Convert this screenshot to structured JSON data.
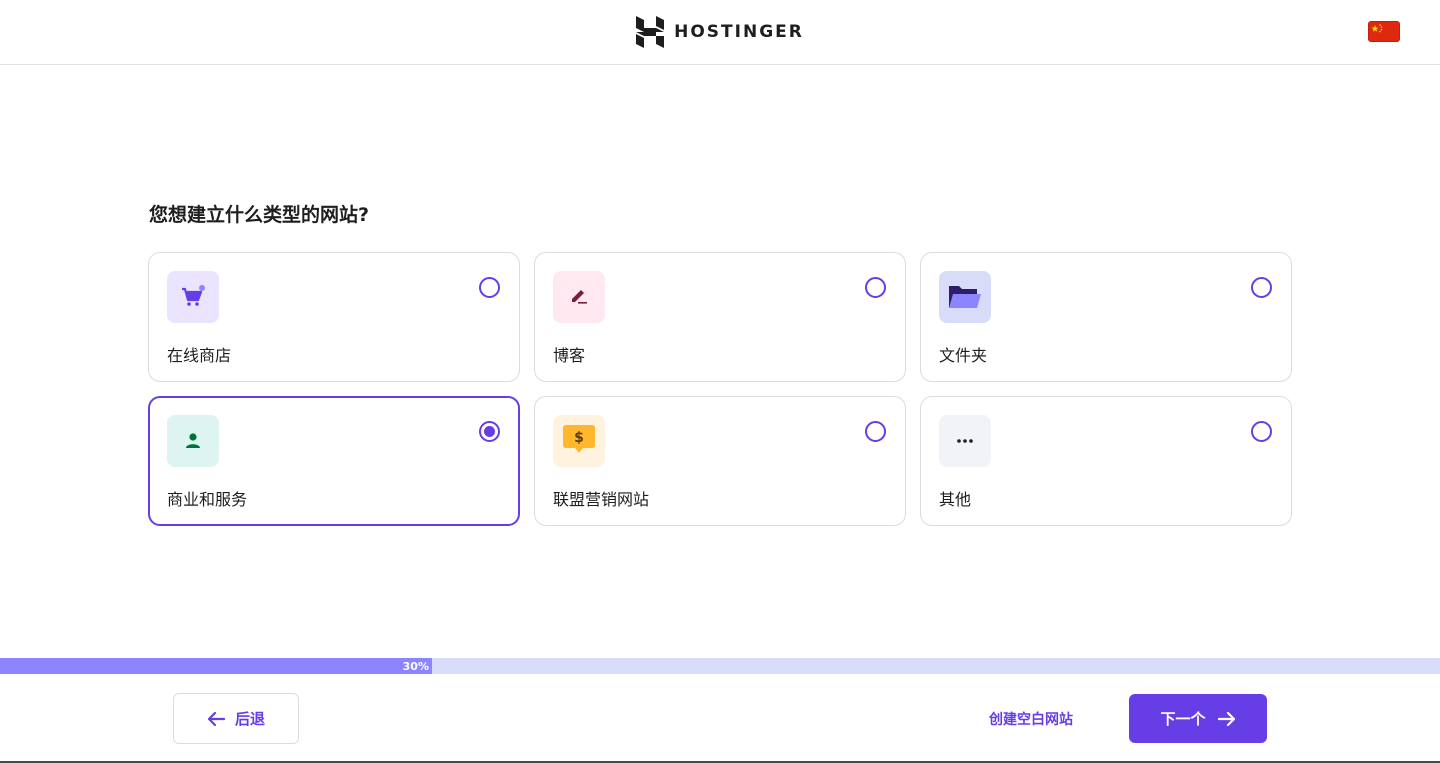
{
  "header": {
    "brand": "HOSTINGER",
    "language_flag_icon": "china-flag-icon"
  },
  "question": "您想建立什么类型的网站?",
  "options": [
    {
      "label": "在线商店",
      "icon": "shopping-cart-icon",
      "icon_bg": "#ebe4ff",
      "icon_color": "#673de6",
      "selected": false
    },
    {
      "label": "博客",
      "icon": "pencil-icon",
      "icon_bg": "#ffe8ef",
      "icon_color": "#7a1d3a",
      "selected": false
    },
    {
      "label": "文件夹",
      "icon": "folder-icon",
      "icon_bg": "#d8dcf9",
      "icon_color": "#2f1c6a",
      "selected": false
    },
    {
      "label": "商业和服务",
      "icon": "person-icon",
      "icon_bg": "#def4f0",
      "icon_color": "#00733c",
      "selected": true
    },
    {
      "label": "联盟营销网站",
      "icon": "dollar-tag-icon",
      "icon_bg": "#fff3e0",
      "icon_color": "#ffb82e",
      "selected": false
    },
    {
      "label": "其他",
      "icon": "more-dots-icon",
      "icon_bg": "#f2f3f6",
      "icon_color": "#1d1e20",
      "selected": false
    }
  ],
  "progress": {
    "value": 0.3,
    "label": "30%"
  },
  "footer": {
    "back_label": "后退",
    "blank_site_label": "创建空白网站",
    "next_label": "下一个"
  },
  "colors": {
    "accent": "#673de6",
    "progress_fill": "#8c85ff",
    "progress_track": "#d8dcf9"
  }
}
